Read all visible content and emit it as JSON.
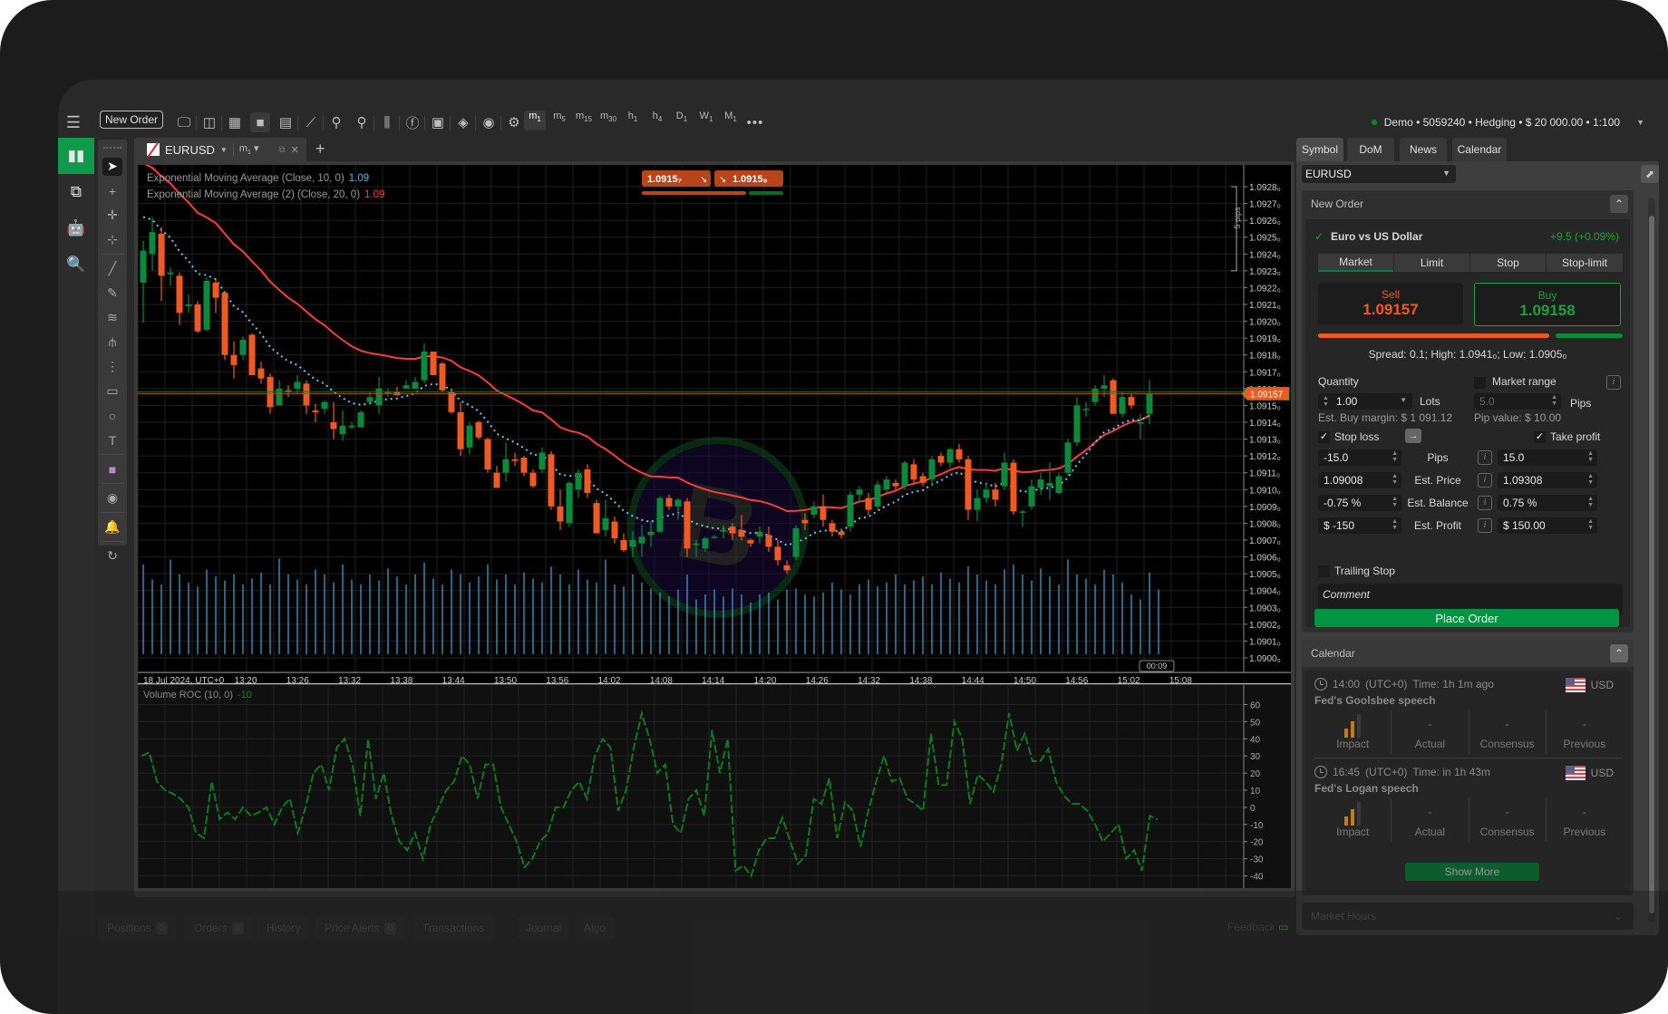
{
  "topbar": {
    "new_order_label": "New Order",
    "icons": [
      "monitor-chart-icon",
      "layout-icon",
      "grid-4-icon",
      "single-view-icon",
      "split-view-icon",
      "add-indicator-icon",
      "zoom-out-icon",
      "zoom-in-icon",
      "candlestick-type-icon",
      "facebook-icon",
      "cbot-icon",
      "layers-icon",
      "eye-icon",
      "chart-settings-icon"
    ],
    "timeframes": [
      {
        "l": "m",
        "s": "1",
        "active": true
      },
      {
        "l": "m",
        "s": "5"
      },
      {
        "l": "m",
        "s": "15"
      },
      {
        "l": "m",
        "s": "30"
      },
      {
        "l": "h",
        "s": "1"
      },
      {
        "l": "h",
        "s": "4"
      },
      {
        "l": "D",
        "s": "1"
      },
      {
        "l": "W",
        "s": "1"
      },
      {
        "l": "M",
        "s": "1"
      }
    ],
    "more_label": "•••",
    "account": "Demo • 5059240 • Hedging • $ 20 000.00 • 1:100",
    "account_caret": "▼",
    "status_color": "#0c8a22"
  },
  "leftnav": {
    "items": [
      {
        "name": "trade-icon",
        "glyph": "▮▮",
        "active": true
      },
      {
        "name": "copy-icon",
        "glyph": "⧉"
      },
      {
        "name": "automate-robot-icon",
        "glyph": "🤖"
      },
      {
        "name": "analyze-search-icon",
        "glyph": "🔍"
      }
    ]
  },
  "drawtools": [
    {
      "name": "cursor-icon",
      "g": "➤",
      "active": true
    },
    {
      "name": "crosshair-icon",
      "g": "+"
    },
    {
      "name": "crosshair-measure-icon",
      "g": "✛"
    },
    {
      "name": "zoom-rect-icon",
      "g": "⊹"
    },
    {
      "sep": true
    },
    {
      "name": "trendline-icon",
      "g": "╱"
    },
    {
      "name": "brush-icon",
      "g": "✎"
    },
    {
      "name": "elliott-icon",
      "g": "≋"
    },
    {
      "name": "pitchfork-icon",
      "g": "⫛"
    },
    {
      "name": "fibonacci-icon",
      "g": "⋮"
    },
    {
      "name": "rectangle-icon",
      "g": "▭"
    },
    {
      "name": "ellipse-icon",
      "g": "○"
    },
    {
      "name": "text-icon",
      "g": "T"
    },
    {
      "sep": true
    },
    {
      "name": "color-swatch-icon",
      "g": "■"
    },
    {
      "sep": true
    },
    {
      "name": "camera-icon",
      "g": "◉"
    },
    {
      "sep": true
    },
    {
      "name": "alert-bell-icon",
      "g": "🔔"
    },
    {
      "sep": true
    },
    {
      "name": "replay-icon",
      "g": "↻"
    }
  ],
  "chart_tab": {
    "symbol": "EURUSD",
    "timeframe": "m",
    "timeframe_sub": "1",
    "add": "+",
    "close": "✕",
    "detach": "⧉"
  },
  "chart": {
    "indicator1": "Exponential Moving Average (Close, 10, 0)",
    "indicator1_value": "1.09",
    "indicator1_color": "#5bb8e8",
    "indicator2": "Exponential Moving Average (2) (Close, 20, 0)",
    "indicator2_value": "1.09",
    "indicator2_color": "#ff3b3b",
    "sell_quick": "1.0915₇",
    "buy_quick": "1.0915₈",
    "current_price": "1.09157",
    "pips_label": "5 pips",
    "countdown": "00:09",
    "date_label": "18 Jul 2024, UTC+0",
    "x_ticks": [
      "13:20",
      "13:26",
      "13:32",
      "13:38",
      "13:44",
      "13:50",
      "13:56",
      "14:02",
      "14:08",
      "14:14",
      "14:20",
      "14:26",
      "14:32",
      "14:38",
      "14:44",
      "14:50",
      "14:56",
      "15:02",
      "15:08"
    ],
    "y_ticks": [
      "1.0928₀",
      "1.0927₀",
      "1.0926₀",
      "1.0925₀",
      "1.0924₀",
      "1.0923₀",
      "1.0922₀",
      "1.0921₀",
      "1.0920₀",
      "1.0919₀",
      "1.0918₀",
      "1.0917₀",
      "1.0916₀",
      "1.0915₀",
      "1.0914₀",
      "1.0913₀",
      "1.0912₀",
      "1.0911₀",
      "1.0910₀",
      "1.0909₀",
      "1.0908₀",
      "1.0907₀",
      "1.0906₀",
      "1.0905₀",
      "1.0904₀",
      "1.0903₀",
      "1.0902₀",
      "1.0901₀",
      "1.0900₀"
    ],
    "osc_label": "Volume ROC (10, 0)",
    "osc_value": "-10",
    "osc_ticks": [
      "60",
      "50",
      "40",
      "30",
      "20",
      "10",
      "0",
      "-10",
      "-20",
      "-30",
      "-40"
    ],
    "up_color": "#0a8a3a",
    "down_color": "#f05a22"
  },
  "chart_data": {
    "type": "candlestick",
    "symbol": "EURUSD",
    "timeframe": "m1",
    "ylim": [
      1.09,
      1.0928
    ],
    "osc_ylim": [
      -45,
      65
    ],
    "candles": [
      [
        1.09223,
        1.09248,
        1.09199,
        1.09242
      ],
      [
        1.0924,
        1.09262,
        1.0923,
        1.09253
      ],
      [
        1.09252,
        1.09256,
        1.09212,
        1.09227
      ],
      [
        1.09228,
        1.09232,
        1.09221,
        1.09229
      ],
      [
        1.09227,
        1.09229,
        1.09198,
        1.09205
      ],
      [
        1.09209,
        1.09216,
        1.09205,
        1.0921
      ],
      [
        1.0921,
        1.09212,
        1.09193,
        1.09194
      ],
      [
        1.09195,
        1.09226,
        1.09194,
        1.09224
      ],
      [
        1.09223,
        1.09225,
        1.09205,
        1.09214
      ],
      [
        1.09217,
        1.09218,
        1.09177,
        1.0918
      ],
      [
        1.0918,
        1.09188,
        1.09166,
        1.09174
      ],
      [
        1.0918,
        1.09191,
        1.09177,
        1.09189
      ],
      [
        1.09192,
        1.09193,
        1.09168,
        1.09168
      ],
      [
        1.09172,
        1.09176,
        1.09163,
        1.09166
      ],
      [
        1.09167,
        1.09169,
        1.09145,
        1.09149
      ],
      [
        1.0915,
        1.09165,
        1.0915,
        1.0916
      ],
      [
        1.09159,
        1.09162,
        1.09155,
        1.09158
      ],
      [
        1.0916,
        1.09168,
        1.09157,
        1.09164
      ],
      [
        1.09163,
        1.09165,
        1.09145,
        1.0915
      ],
      [
        1.09147,
        1.09151,
        1.0914,
        1.09146
      ],
      [
        1.09148,
        1.09153,
        1.09145,
        1.09152
      ],
      [
        1.0914,
        1.09152,
        1.0913,
        1.09136
      ],
      [
        1.09133,
        1.09147,
        1.09129,
        1.09138
      ],
      [
        1.09137,
        1.0914,
        1.09136,
        1.09138
      ],
      [
        1.09137,
        1.09147,
        1.09137,
        1.09146
      ],
      [
        1.09152,
        1.09158,
        1.09152,
        1.09155
      ],
      [
        1.0915,
        1.09167,
        1.09145,
        1.0916
      ],
      [
        1.09157,
        1.0916,
        1.09155,
        1.09158
      ],
      [
        1.09158,
        1.09161,
        1.09156,
        1.09156
      ],
      [
        1.0916,
        1.09165,
        1.0916,
        1.09162
      ],
      [
        1.0916,
        1.09167,
        1.0916,
        1.09164
      ],
      [
        1.09165,
        1.09187,
        1.09163,
        1.09182
      ],
      [
        1.09182,
        1.09182,
        1.0917,
        1.09168
      ],
      [
        1.09175,
        1.09176,
        1.09158,
        1.09159
      ],
      [
        1.09158,
        1.0916,
        1.09145,
        1.09146
      ],
      [
        1.09146,
        1.09152,
        1.0912,
        1.09124
      ],
      [
        1.09125,
        1.0914,
        1.09121,
        1.09138
      ],
      [
        1.0914,
        1.09141,
        1.0913,
        1.09131
      ],
      [
        1.0913,
        1.09131,
        1.0911,
        1.09112
      ],
      [
        1.0911,
        1.09114,
        1.09101,
        1.09101
      ],
      [
        1.0911,
        1.09128,
        1.09105,
        1.09118
      ],
      [
        1.09118,
        1.09122,
        1.09114,
        1.09117
      ],
      [
        1.09119,
        1.0912,
        1.09108,
        1.0911
      ],
      [
        1.0911,
        1.09112,
        1.09101,
        1.09102
      ],
      [
        1.09112,
        1.09125,
        1.0911,
        1.09122
      ],
      [
        1.09121,
        1.09123,
        1.09088,
        1.0909
      ],
      [
        1.0909,
        1.091,
        1.09076,
        1.09081
      ],
      [
        1.0908,
        1.09105,
        1.09078,
        1.09104
      ],
      [
        1.091,
        1.09112,
        1.09095,
        1.0911
      ],
      [
        1.09112,
        1.09115,
        1.09095,
        1.09098
      ],
      [
        1.09092,
        1.09094,
        1.09074,
        1.09074
      ],
      [
        1.09076,
        1.09094,
        1.09072,
        1.09083
      ],
      [
        1.09081,
        1.09084,
        1.09068,
        1.09071
      ],
      [
        1.0907,
        1.09074,
        1.09063,
        1.09064
      ],
      [
        1.09066,
        1.09075,
        1.0906,
        1.0907
      ],
      [
        1.09068,
        1.09079,
        1.0906,
        1.09072
      ],
      [
        1.09073,
        1.09081,
        1.09066,
        1.09075
      ],
      [
        1.09075,
        1.09096,
        1.09074,
        1.09095
      ],
      [
        1.09095,
        1.09097,
        1.09088,
        1.0909
      ],
      [
        1.0909,
        1.09095,
        1.09082,
        1.09094
      ],
      [
        1.09093,
        1.09095,
        1.0906,
        1.09065
      ],
      [
        1.09067,
        1.0907,
        1.0906,
        1.09068
      ],
      [
        1.09065,
        1.09072,
        1.09063,
        1.09071
      ],
      [
        1.09072,
        1.09073,
        1.09071,
        1.09072
      ],
      [
        1.09075,
        1.09079,
        1.09071,
        1.09076
      ],
      [
        1.09078,
        1.0908,
        1.0907,
        1.09074
      ],
      [
        1.09076,
        1.09085,
        1.0907,
        1.09072
      ],
      [
        1.0907,
        1.09071,
        1.09066,
        1.09068
      ],
      [
        1.09072,
        1.09078,
        1.09068,
        1.09075
      ],
      [
        1.09073,
        1.09078,
        1.09063,
        1.09066
      ],
      [
        1.09066,
        1.0907,
        1.09055,
        1.09058
      ],
      [
        1.09055,
        1.09058,
        1.0905,
        1.09052
      ],
      [
        1.0906,
        1.09079,
        1.09058,
        1.09077
      ],
      [
        1.09082,
        1.09086,
        1.09076,
        1.0908
      ],
      [
        1.09085,
        1.09093,
        1.09083,
        1.0909
      ],
      [
        1.0909,
        1.09097,
        1.09078,
        1.09082
      ],
      [
        1.0908,
        1.09082,
        1.09072,
        1.09075
      ],
      [
        1.09075,
        1.09077,
        1.09071,
        1.09073
      ],
      [
        1.09078,
        1.09099,
        1.09075,
        1.09097
      ],
      [
        1.09097,
        1.09102,
        1.09092,
        1.091
      ],
      [
        1.09095,
        1.09098,
        1.09085,
        1.09088
      ],
      [
        1.0909,
        1.09105,
        1.09088,
        1.09103
      ],
      [
        1.091,
        1.09108,
        1.09098,
        1.09106
      ],
      [
        1.09104,
        1.09106,
        1.091,
        1.09102
      ],
      [
        1.09102,
        1.09117,
        1.091,
        1.09116
      ],
      [
        1.09115,
        1.09118,
        1.09103,
        1.09106
      ],
      [
        1.09108,
        1.0911,
        1.09102,
        1.09104
      ],
      [
        1.09106,
        1.0912,
        1.09102,
        1.09118
      ],
      [
        1.0912,
        1.09122,
        1.09114,
        1.09116
      ],
      [
        1.09116,
        1.09125,
        1.09113,
        1.09124
      ],
      [
        1.09124,
        1.09127,
        1.09116,
        1.09118
      ],
      [
        1.09118,
        1.0912,
        1.09082,
        1.09088
      ],
      [
        1.09088,
        1.091,
        1.09081,
        1.09095
      ],
      [
        1.09095,
        1.09104,
        1.09092,
        1.091
      ],
      [
        1.091,
        1.09104,
        1.0909,
        1.09094
      ],
      [
        1.09102,
        1.09122,
        1.091,
        1.09116
      ],
      [
        1.09116,
        1.09118,
        1.09085,
        1.09087
      ],
      [
        1.09087,
        1.09088,
        1.09078,
        1.09087
      ],
      [
        1.0909,
        1.09106,
        1.09088,
        1.09102
      ],
      [
        1.09101,
        1.0911,
        1.09097,
        1.09106
      ],
      [
        1.09102,
        1.09116,
        1.09094,
        1.09104
      ],
      [
        1.09098,
        1.0911,
        1.09097,
        1.09108
      ],
      [
        1.0911,
        1.0913,
        1.09108,
        1.09128
      ],
      [
        1.09128,
        1.09155,
        1.09126,
        1.0915
      ],
      [
        1.09148,
        1.09152,
        1.09143,
        1.09148
      ],
      [
        1.09152,
        1.09162,
        1.0915,
        1.0916
      ],
      [
        1.0916,
        1.09168,
        1.09155,
        1.09162
      ],
      [
        1.09165,
        1.09166,
        1.09145,
        1.09145
      ],
      [
        1.09145,
        1.09158,
        1.09143,
        1.09155
      ],
      [
        1.09155,
        1.09157,
        1.09148,
        1.0915
      ],
      [
        1.0914,
        1.09145,
        1.0913,
        1.0914
      ],
      [
        1.09145,
        1.09165,
        1.09139,
        1.09157
      ]
    ],
    "volumes": [
      0.9,
      0.75,
      0.7,
      0.95,
      0.8,
      0.72,
      0.68,
      0.85,
      0.78,
      0.74,
      0.8,
      0.7,
      0.76,
      0.82,
      0.7,
      0.96,
      0.8,
      0.75,
      0.7,
      0.85,
      0.8,
      0.72,
      0.9,
      0.75,
      0.7,
      0.8,
      0.74,
      0.86,
      0.78,
      0.7,
      0.8,
      0.92,
      0.76,
      0.7,
      0.85,
      0.8,
      0.72,
      0.78,
      0.9,
      0.75,
      0.8,
      0.7,
      0.82,
      0.76,
      0.72,
      0.88,
      0.8,
      0.7,
      0.85,
      0.75,
      0.72,
      0.95,
      0.7,
      0.68,
      0.8,
      0.72,
      0.66,
      0.62,
      0.58,
      0.65,
      0.8,
      0.55,
      0.6,
      0.65,
      0.58,
      0.66,
      0.6,
      0.52,
      0.6,
      0.62,
      0.55,
      0.65,
      0.66,
      0.6,
      0.58,
      0.62,
      0.72,
      0.65,
      0.6,
      0.7,
      0.75,
      0.68,
      0.72,
      0.8,
      0.7,
      0.74,
      0.78,
      0.7,
      0.82,
      0.76,
      0.72,
      0.88,
      0.8,
      0.74,
      0.7,
      0.85,
      0.9,
      0.8,
      0.74,
      0.86,
      0.78,
      0.7,
      0.95,
      0.8,
      0.76,
      0.7,
      0.85,
      0.8,
      0.72,
      0.6,
      0.55,
      0.82,
      0.65
    ],
    "osc": [
      30,
      32,
      15,
      10,
      8,
      5,
      0,
      -15,
      -18,
      15,
      -7,
      -3,
      -7,
      0,
      -5,
      -3,
      0,
      -10,
      0,
      5,
      -15,
      0,
      20,
      25,
      10,
      35,
      40,
      25,
      -5,
      40,
      5,
      20,
      -5,
      -20,
      -25,
      -15,
      -30,
      -10,
      0,
      10,
      15,
      30,
      25,
      5,
      25,
      25,
      0,
      -10,
      -20,
      -35,
      -30,
      -20,
      -15,
      0,
      0,
      10,
      15,
      5,
      30,
      40,
      35,
      -2,
      10,
      35,
      55,
      40,
      20,
      25,
      -10,
      -15,
      5,
      10,
      -5,
      45,
      20,
      40,
      -37,
      -34,
      -40,
      -25,
      -18,
      -18,
      -6,
      -20,
      -33,
      -28,
      5,
      2,
      17,
      -18,
      3,
      -2,
      -23,
      -2,
      15,
      30,
      15,
      17,
      5,
      2,
      -2,
      43,
      13,
      13,
      50,
      40,
      2,
      19,
      15,
      9,
      25,
      55,
      33,
      43,
      27,
      27,
      34,
      15,
      7,
      2,
      2,
      -2,
      -10,
      -20,
      -15,
      -10,
      -30,
      -25,
      -37,
      -5,
      -7
    ],
    "ema10_color": "#6ec6f0",
    "ema20_color": "#ff3b3b"
  },
  "right_panel": {
    "tabs": [
      "Symbol",
      "DoM",
      "News",
      "Calendar"
    ],
    "symbol": "EURUSD",
    "new_order": {
      "title": "New Order",
      "instrument": "Euro vs US Dollar",
      "change": "+9.5 (+0.09%)",
      "order_types": [
        "Market",
        "Limit",
        "Stop",
        "Stop-limit"
      ],
      "sell_label": "Sell",
      "sell_price": "1.09157",
      "buy_label": "Buy",
      "buy_price": "1.09158",
      "sell_ratio": 0.77,
      "spread_line": "Spread: 0.1; High: 1.0941₀; Low: 1.0905₀",
      "quantity_label": "Quantity",
      "quantity": "1.00",
      "lots_label": "Lots",
      "market_range_label": "Market range",
      "market_range_value": "5.0",
      "pips_label": "Pips",
      "est_margin": "Est. Buy margin: $ 1 091.12",
      "pip_value": "Pip value: $ 10.00",
      "stop_loss_label": "Stop loss",
      "take_profit_label": "Take profit",
      "rows": [
        {
          "label": "Pips",
          "sl": "-15.0",
          "tp": "15.0"
        },
        {
          "label": "Est. Price",
          "sl": "1.09008",
          "tp": "1.09308"
        },
        {
          "label": "Est. Balance",
          "sl": "-0.75 %",
          "tp": "0.75 %"
        },
        {
          "label": "Est. Profit",
          "sl": "$ -150",
          "tp": "$ 150.00"
        }
      ],
      "trailing_stop_label": "Trailing Stop",
      "comment_placeholder": "Comment",
      "place_order_label": "Place Order"
    },
    "calendar": {
      "title": "Calendar",
      "events": [
        {
          "time": "14:00",
          "tz": "(UTC+0)",
          "rel": "Time: 1h 1m ago",
          "title": "Fed's Goolsbee speech",
          "currency": "USD",
          "actual": "-",
          "consensus": "-",
          "previous": "-"
        },
        {
          "time": "16:45",
          "tz": "(UTC+0)",
          "rel": "Time: in 1h 43m",
          "title": "Fed's Logan speech",
          "currency": "USD",
          "actual": "-",
          "consensus": "-",
          "previous": "-"
        }
      ],
      "col_labels": [
        "Impact",
        "Actual",
        "Consensus",
        "Previous"
      ],
      "show_more": "Show More"
    },
    "market_hours": "Market Hours"
  },
  "bottom_tabs": [
    {
      "label": "Positions",
      "count": "0"
    },
    {
      "label": "Orders",
      "count": "0"
    },
    {
      "label": "History"
    },
    {
      "label": "Price Alerts",
      "count": "0"
    },
    {
      "label": "Transactions"
    },
    {
      "label": "Journal"
    },
    {
      "label": "Algo"
    }
  ],
  "feedback_label": "Feedback"
}
